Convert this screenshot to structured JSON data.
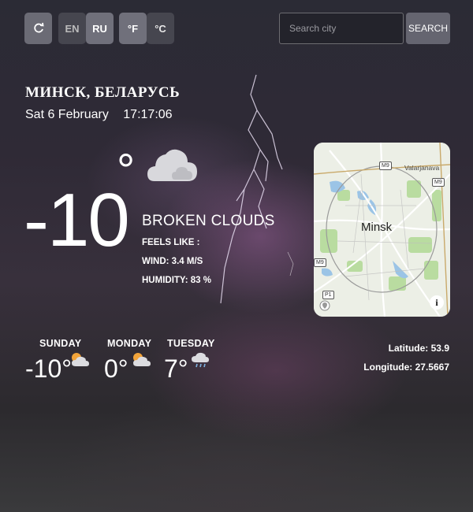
{
  "toolbar": {
    "refresh_icon": "refresh-icon",
    "lang_en": "EN",
    "lang_ru": "RU",
    "unit_f": "°F",
    "unit_c": "°C",
    "search_placeholder": "Search city",
    "search_label": "SEARCH"
  },
  "location": {
    "city": "МИНСК, БЕЛАРУСЬ",
    "date": "Sat 6 February",
    "time": "17:17:06"
  },
  "current": {
    "temperature": "-10",
    "degree_symbol": "°",
    "condition_icon": "cloud-icon",
    "description": "BROKEN CLOUDS",
    "feels_like": "FEELS LIKE :",
    "wind": "WIND: 3.4 M/S",
    "humidity": "HUMIDITY: 83 %"
  },
  "map": {
    "city_label": "Minsk",
    "place_label": "Valarjanava",
    "road_m9_top": "M9",
    "road_m9_right": "M9",
    "road_m9_left": "M9",
    "road_p1": "P1"
  },
  "forecast": [
    {
      "day": "SUNDAY",
      "temp": "-10°",
      "icon": "sun-behind-cloud-icon"
    },
    {
      "day": "MONDAY",
      "temp": "0°",
      "icon": "sun-behind-cloud-icon"
    },
    {
      "day": "TUESDAY",
      "temp": "7°",
      "icon": "rain-cloud-icon"
    }
  ],
  "coordinates": {
    "latitude": "Latitude: 53.9",
    "longitude": "Longitude: 27.5667"
  }
}
